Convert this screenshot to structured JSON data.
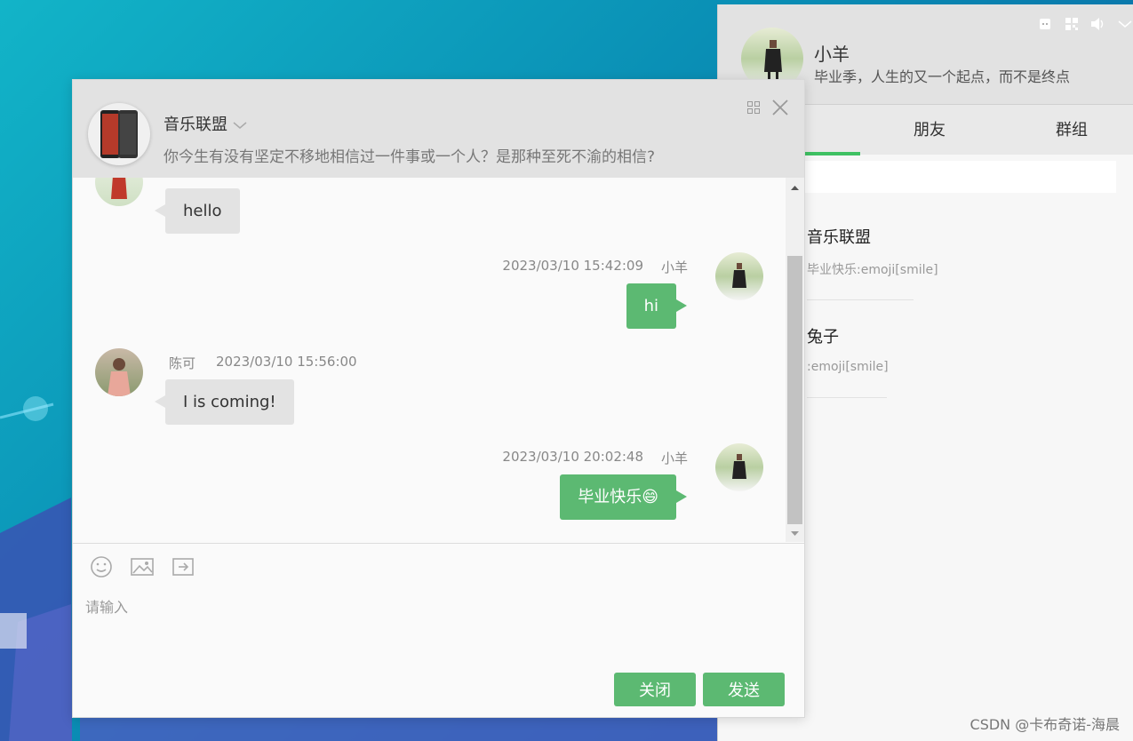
{
  "main_window": {
    "user_name": "小羊",
    "signature": "毕业季，人生的又一个起点，而不是终点",
    "tabs": [
      {
        "label": "朋友"
      },
      {
        "label": "群组"
      }
    ],
    "active_tab_color": "#3fc163",
    "contacts": [
      {
        "name": "音乐联盟",
        "last_message": "毕业快乐:emoji[smile]"
      },
      {
        "name": "兔子",
        "last_message": ":emoji[smile]"
      }
    ]
  },
  "chat": {
    "title": "音乐联盟",
    "subtitle": "你今生有没有坚定不移地相信过一件事或一个人？是那种至死不渝的相信?",
    "messages": [
      {
        "side": "left",
        "sender": "",
        "time": "",
        "text": "hello"
      },
      {
        "side": "right",
        "sender": "小羊",
        "time": "2023/03/10 15:42:09",
        "text": "hi"
      },
      {
        "side": "left",
        "sender": "陈可",
        "time": "2023/03/10 15:56:00",
        "text": "I is coming!"
      },
      {
        "side": "right",
        "sender": "小羊",
        "time": "2023/03/10 20:02:48",
        "text": "毕业快乐😄"
      }
    ],
    "input_placeholder": "请输入",
    "close_label": "关闭",
    "send_label": "发送"
  },
  "watermark": "CSDN @卡布奇诺-海晨",
  "colors": {
    "accent": "#5cb972",
    "header_bg": "#e2e2e2"
  }
}
